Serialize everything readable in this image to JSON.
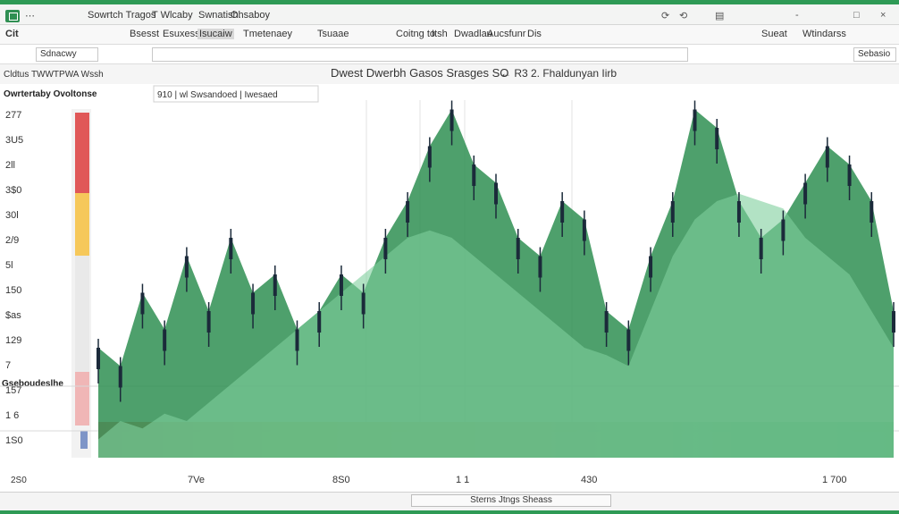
{
  "window": {
    "tabs": [
      "Sowrtch Tragos",
      "T Wlcaby",
      "Swnatish.",
      "Ohsaboy"
    ],
    "controls": [
      "-",
      "□",
      "×"
    ]
  },
  "ribbon": {
    "left_label": "Cit",
    "menu": [
      "Bsesst",
      "Esuxess",
      "Isucaiw",
      "Tmetenaey",
      "Tsuaae"
    ],
    "menu_right": [
      "Coitng to",
      "Itsh",
      "Dwadlau",
      "Aucsfunr",
      "Dis"
    ],
    "right_items": [
      "Sueat",
      "Wtindarss"
    ]
  },
  "formula_bar": {
    "name_box": "Sdnacwy",
    "formula": "",
    "right_box": "Sebasio"
  },
  "chart_header": {
    "left_label": "Cldtus TWWTPWA Wssh",
    "title": "Dwest Dwerbh Gasos Srasges SO",
    "subtitle": "← R3 2. Fhaldunyan Iirb"
  },
  "panel": {
    "title": "Owrtertaby Ovoltonse",
    "legend_text": "910 | wl Swsandoed | Iwesaed",
    "section_label": "Gseboudeslhe"
  },
  "chart_data": {
    "type": "area",
    "x_ticks": [
      "7Ve",
      "8S0",
      "1 1",
      "430",
      "1 700"
    ],
    "y_ticks": [
      "277",
      "3U5",
      "2ll",
      "3$0",
      "30l",
      "2/9",
      "5l",
      "150",
      "$as",
      "129",
      "7",
      "157",
      "1 6",
      "1S0"
    ],
    "bottom_left": "2S0",
    "series": [
      {
        "name": "",
        "color": "#2f8f52",
        "values": [
          0.3,
          0.25,
          0.45,
          0.35,
          0.55,
          0.4,
          0.6,
          0.45,
          0.5,
          0.35,
          0.4,
          0.5,
          0.45,
          0.6,
          0.7,
          0.85,
          0.95,
          0.8,
          0.75,
          0.6,
          0.55,
          0.7,
          0.65,
          0.4,
          0.35,
          0.55,
          0.7,
          0.95,
          0.9,
          0.7,
          0.6,
          0.65,
          0.75,
          0.85,
          0.8,
          0.7,
          0.4
        ]
      },
      {
        "name": "",
        "color": "#7fcf9c",
        "values": [
          0.05,
          0.1,
          0.08,
          0.12,
          0.1,
          0.15,
          0.2,
          0.25,
          0.3,
          0.35,
          0.4,
          0.45,
          0.5,
          0.55,
          0.6,
          0.62,
          0.6,
          0.55,
          0.5,
          0.45,
          0.4,
          0.35,
          0.3,
          0.28,
          0.25,
          0.4,
          0.55,
          0.65,
          0.7,
          0.72,
          0.7,
          0.68,
          0.6,
          0.55,
          0.5,
          0.4,
          0.3
        ]
      }
    ]
  }
}
